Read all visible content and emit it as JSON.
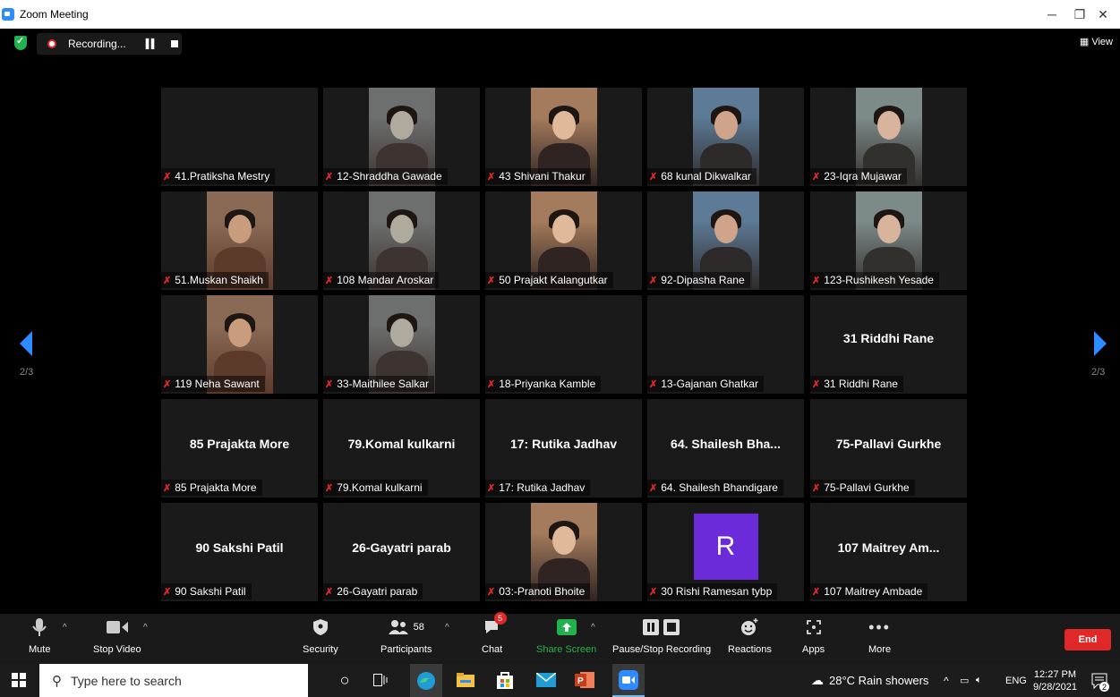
{
  "window": {
    "title": "Zoom Meeting"
  },
  "recording": {
    "label": "Recording..."
  },
  "view": {
    "label": "View"
  },
  "pager": {
    "left": "2/3",
    "right": "2/3"
  },
  "participants": [
    {
      "label": "41.Pratiksha Mestry",
      "video": false,
      "display": ""
    },
    {
      "label": "12-Shraddha Gawade",
      "video": true,
      "display": ""
    },
    {
      "label": "43 Shivani Thakur",
      "video": true,
      "display": ""
    },
    {
      "label": "68 kunal Dikwalkar",
      "video": true,
      "display": ""
    },
    {
      "label": "23-Iqra Mujawar",
      "video": true,
      "display": ""
    },
    {
      "label": "51.Muskan Shaikh",
      "video": true,
      "display": ""
    },
    {
      "label": "108 Mandar Aroskar",
      "video": true,
      "display": ""
    },
    {
      "label": "50 Prajakt Kalangutkar",
      "video": true,
      "display": ""
    },
    {
      "label": "92-Dipasha Rane",
      "video": true,
      "display": ""
    },
    {
      "label": "123-Rushikesh Yesade",
      "video": true,
      "display": ""
    },
    {
      "label": "119 Neha Sawant",
      "video": true,
      "display": ""
    },
    {
      "label": "33-Maithilee Salkar",
      "video": true,
      "display": ""
    },
    {
      "label": "18-Priyanka Kamble",
      "video": false,
      "display": ""
    },
    {
      "label": "13-Gajanan Ghatkar",
      "video": false,
      "display": ""
    },
    {
      "label": "31 Riddhi Rane",
      "video": false,
      "display": "31 Riddhi Rane"
    },
    {
      "label": "85 Prajakta More",
      "video": false,
      "display": "85 Prajakta More"
    },
    {
      "label": "79.Komal kulkarni",
      "video": false,
      "display": "79.Komal kulkarni"
    },
    {
      "label": "17: Rutika Jadhav",
      "video": false,
      "display": "17: Rutika Jadhav"
    },
    {
      "label": "64. Shailesh Bhandigare",
      "video": false,
      "display": "64. Shailesh Bha..."
    },
    {
      "label": "75-Pallavi Gurkhe",
      "video": false,
      "display": "75-Pallavi Gurkhe"
    },
    {
      "label": "90 Sakshi Patil",
      "video": false,
      "display": "90 Sakshi Patil"
    },
    {
      "label": "26-Gayatri parab",
      "video": false,
      "display": "26-Gayatri parab"
    },
    {
      "label": "03:-Pranoti Bhoite",
      "video": true,
      "display": ""
    },
    {
      "label": "30 Rishi Ramesan tybp",
      "video": false,
      "display": "",
      "avatar": "R"
    },
    {
      "label": "107 Maitrey Ambade",
      "video": false,
      "display": "107 Maitrey Am..."
    }
  ],
  "toolbar": {
    "mute": "Mute",
    "stop_video": "Stop Video",
    "security": "Security",
    "participants": "Participants",
    "participant_count": "58",
    "chat": "Chat",
    "chat_badge": "5",
    "share_screen": "Share Screen",
    "pause_recording": "Pause/Stop Recording",
    "reactions": "Reactions",
    "apps": "Apps",
    "more": "More",
    "end": "End"
  },
  "taskbar": {
    "search_placeholder": "Type here to search",
    "weather": "28°C  Rain showers",
    "lang": "ENG",
    "time": "12:27 PM",
    "date": "9/28/2021",
    "notif_count": "2"
  },
  "colors": {
    "accent": "#2d8cff",
    "end": "#e02828",
    "share": "#23b14d",
    "avatar": "#6c2bd9"
  }
}
